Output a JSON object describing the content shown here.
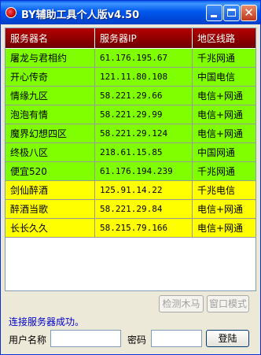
{
  "window": {
    "title": "BY辅助工具个人版v4.50"
  },
  "table": {
    "columns": [
      "服务器名",
      "服务器IP",
      "地区线路"
    ],
    "rows": [
      {
        "name": "屠龙与君相约",
        "ip": "61.176.195.67",
        "region": "千兆网通",
        "color": "#80FF00"
      },
      {
        "name": "开心传奇",
        "ip": "121.11.80.108",
        "region": "中国电信",
        "color": "#80FF00"
      },
      {
        "name": "情缘九区",
        "ip": "58.221.29.66",
        "region": "电信+网通",
        "color": "#80FF00"
      },
      {
        "name": "泡泡有情",
        "ip": "58.221.29.99",
        "region": "电信+网通",
        "color": "#80FF00"
      },
      {
        "name": "魔界幻想四区",
        "ip": "58.221.29.124",
        "region": "电信+网通",
        "color": "#80FF00"
      },
      {
        "name": "终极八区",
        "ip": "218.61.15.85",
        "region": "中国网通",
        "color": "#80FF00"
      },
      {
        "name": "便宜520",
        "ip": "61.176.194.239",
        "region": "千兆网通",
        "color": "#80FF00"
      },
      {
        "name": "剑仙醉酒",
        "ip": "125.91.14.22",
        "region": "千兆电信",
        "color": "#FFFF00"
      },
      {
        "name": "醉酒当歌",
        "ip": "58.221.29.84",
        "region": "电信+网通",
        "color": "#FFFF00"
      },
      {
        "name": "长长久久",
        "ip": "58.215.79.166",
        "region": "电信+网通",
        "color": "#FFFF00"
      }
    ]
  },
  "buttons": {
    "detect": "检测木马",
    "window_mode": "窗口模式",
    "login": "登陆"
  },
  "status": "连接服务器成功。",
  "form": {
    "username_label": "用户名称",
    "username_value": "",
    "password_label": "密码",
    "password_value": ""
  },
  "colors": {
    "header": "#8B0000",
    "row_green": "#80FF00",
    "row_yellow": "#FFFF00",
    "status_text": "#0000CC"
  },
  "icons": {
    "app": "app-logo-icon",
    "minimize": "minimize-icon",
    "maximize": "maximize-icon",
    "close": "close-icon"
  }
}
